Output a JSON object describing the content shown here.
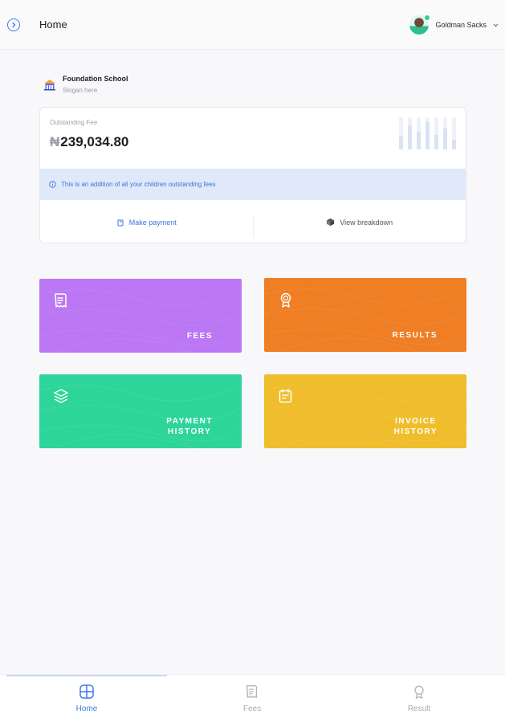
{
  "header": {
    "title": "Home",
    "user_name": "Goldman Sacks"
  },
  "school": {
    "name": "Foundation School",
    "slogan": "Slogan here"
  },
  "fee_card": {
    "label": "Outstanding Fee",
    "currency_symbol": "₦",
    "amount": "239,034.80",
    "notice": "This is an addition of all your children outstanding fees",
    "make_payment_label": "Make payment",
    "view_breakdown_label": "View breakdown"
  },
  "tiles": {
    "fees": "FEES",
    "results": "RESULTS",
    "payment_history_line1": "PAYMENT",
    "payment_history_line2": "HISTORY",
    "invoice_history_line1": "INVOICE",
    "invoice_history_line2": "HISTORY"
  },
  "nav": {
    "home": "Home",
    "fees": "Fees",
    "result": "Result"
  },
  "colors": {
    "accent": "#3c7be6",
    "fees_tile": "#bb77f4",
    "results_tile": "#ef7e24",
    "payment_tile": "#2dd59a",
    "invoice_tile": "#f0bd2c"
  },
  "icons": {
    "toggle": "chevron-right-circle-icon",
    "school": "school-building-icon",
    "info": "info-icon",
    "payment": "wallet-icon",
    "breakdown": "box-icon",
    "fees": "receipt-icon",
    "results": "medal-icon",
    "payment_history": "layers-icon",
    "invoice_history": "invoice-note-icon"
  }
}
